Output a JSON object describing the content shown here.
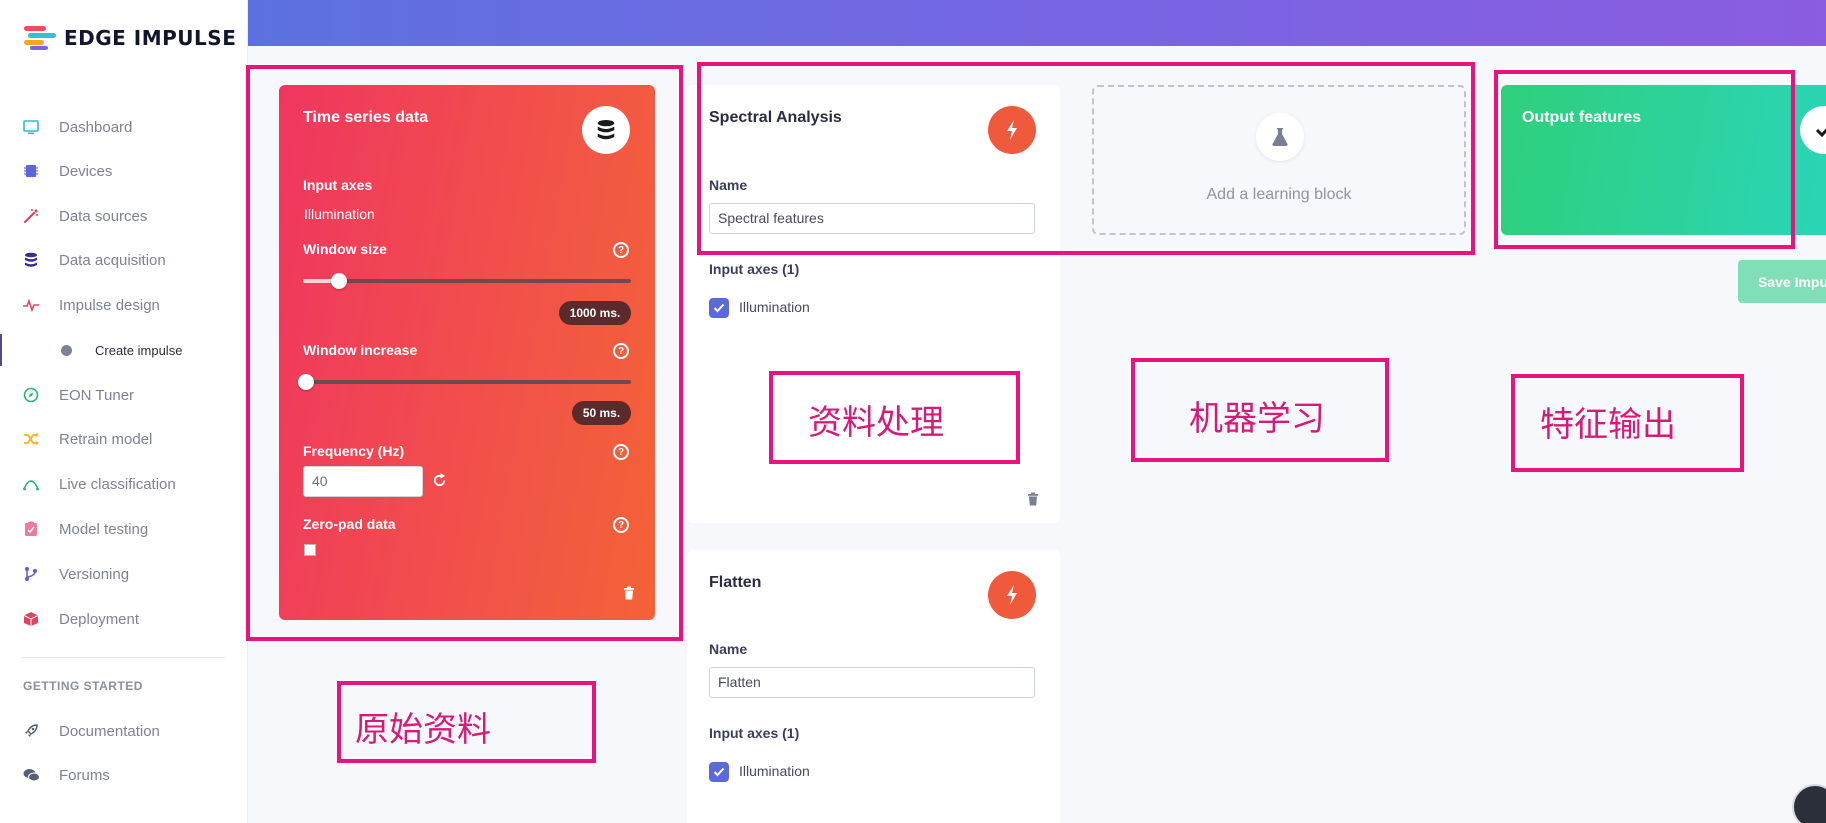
{
  "app": {
    "logo_text": "EDGE IMPULSE"
  },
  "sidebar": {
    "items": [
      {
        "label": "Dashboard",
        "icon": "monitor-icon"
      },
      {
        "label": "Devices",
        "icon": "chip-icon"
      },
      {
        "label": "Data sources",
        "icon": "wand-icon"
      },
      {
        "label": "Data acquisition",
        "icon": "database-icon"
      },
      {
        "label": "Impulse design",
        "icon": "pulse-icon"
      },
      {
        "label": "Create impulse",
        "icon": "dot-icon",
        "active": true
      },
      {
        "label": "EON Tuner",
        "icon": "compass-icon"
      },
      {
        "label": "Retrain model",
        "icon": "shuffle-icon"
      },
      {
        "label": "Live classification",
        "icon": "curve-icon"
      },
      {
        "label": "Model testing",
        "icon": "clipboard-icon"
      },
      {
        "label": "Versioning",
        "icon": "branch-icon"
      },
      {
        "label": "Deployment",
        "icon": "box-icon"
      }
    ],
    "section_label": "GETTING STARTED",
    "getting_started": [
      {
        "label": "Documentation",
        "icon": "rocket-icon"
      },
      {
        "label": "Forums",
        "icon": "chat-icon"
      }
    ]
  },
  "time_series": {
    "title": "Time series data",
    "input_axes_label": "Input axes",
    "input_axes_value": "Illumination",
    "window_size_label": "Window size",
    "window_size_value": "1000 ms.",
    "window_size_level": 0.11,
    "window_increase_label": "Window increase",
    "window_increase_value": "50 ms.",
    "window_increase_level": 0.01,
    "frequency_label": "Frequency (Hz)",
    "frequency_value": "40",
    "zero_pad_label": "Zero-pad data",
    "zero_pad_checked": false
  },
  "spectral": {
    "title": "Spectral Analysis",
    "name_label": "Name",
    "name_value": "Spectral features",
    "input_axes_label": "Input axes (1)",
    "axis_option": "Illumination"
  },
  "flatten": {
    "title": "Flatten",
    "name_label": "Name",
    "name_value": "Flatten",
    "input_axes_label": "Input axes (1)",
    "axis_option": "Illumination"
  },
  "learning": {
    "add_label": "Add a learning block"
  },
  "output": {
    "title": "Output features",
    "save_label": "Save Impu"
  },
  "annotations": {
    "raw_data": "原始资料",
    "processing": "资料处理",
    "machine_learning": "机器学习",
    "feature_output": "特征输出"
  },
  "colors": {
    "accent_magenta": "#e8137f",
    "time_series_gradient": [
      "#f0365f",
      "#f46236"
    ],
    "output_gradient": [
      "#2fcf7b",
      "#2ad5b7"
    ],
    "dsp_button": "#f05a3c",
    "top_banner": [
      "#5c71e0",
      "#8b5de0"
    ]
  }
}
